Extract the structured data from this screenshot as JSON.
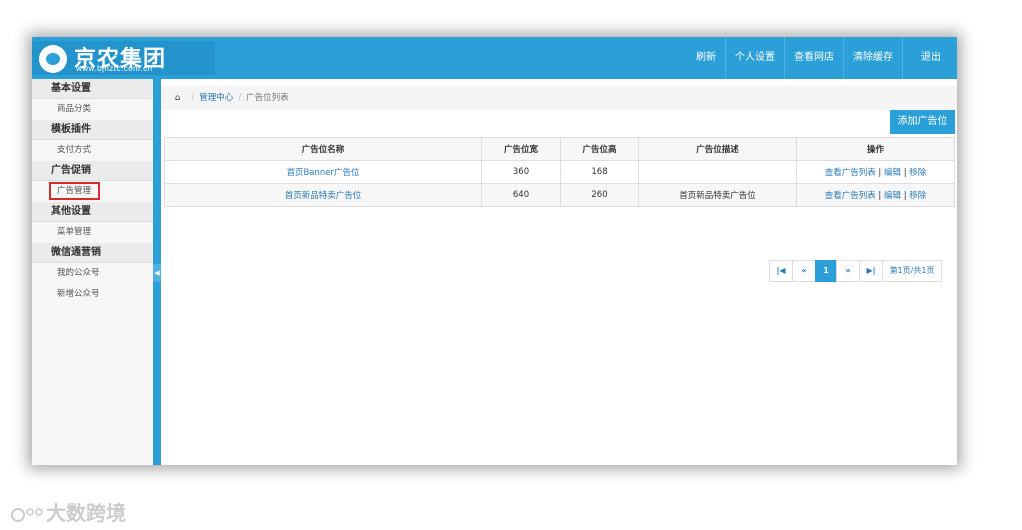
{
  "logo": {
    "title": "京农集团",
    "subtitle": "www.bjnztc.com.cn"
  },
  "nav": [
    "刷新",
    "个人设置",
    "查看网店",
    "清除缓存",
    "退出"
  ],
  "sidebar": [
    {
      "group": "基本设置",
      "items": [
        {
          "label": "商品分类",
          "active": false
        }
      ]
    },
    {
      "group": "模板插件",
      "items": [
        {
          "label": "支付方式",
          "active": false
        }
      ]
    },
    {
      "group": "广告促销",
      "items": [
        {
          "label": "广告管理",
          "active": true
        }
      ]
    },
    {
      "group": "其他设置",
      "items": [
        {
          "label": "菜单管理",
          "active": false
        }
      ]
    },
    {
      "group": "微信通营销",
      "items": [
        {
          "label": "我的公众号",
          "active": false
        },
        {
          "label": "新增公众号",
          "active": false
        }
      ]
    }
  ],
  "breadcrumb": {
    "home_icon": "home-icon",
    "parent": "管理中心",
    "current": "广告位列表"
  },
  "add_button": "添加广告位",
  "table": {
    "headers": [
      "广告位名称",
      "广告位宽",
      "广告位高",
      "广告位描述",
      "操作"
    ],
    "rows": [
      {
        "name": "首页Banner广告位",
        "width": "360",
        "height": "168",
        "desc": "",
        "actions": [
          "查看广告列表",
          "编辑",
          "移除"
        ]
      },
      {
        "name": "首页新品特卖广告位",
        "width": "640",
        "height": "260",
        "desc": "首页新品特卖广告位",
        "actions": [
          "查看广告列表",
          "编辑",
          "移除"
        ]
      }
    ]
  },
  "pager": {
    "first": "⏮",
    "prev": "«",
    "current": "1",
    "next": "»",
    "last": "⏭",
    "info": "第1页/共1页"
  },
  "watermark": "大数跨境",
  "colors": {
    "accent": "#2a9fd8",
    "highlight": "#d62b2b"
  }
}
